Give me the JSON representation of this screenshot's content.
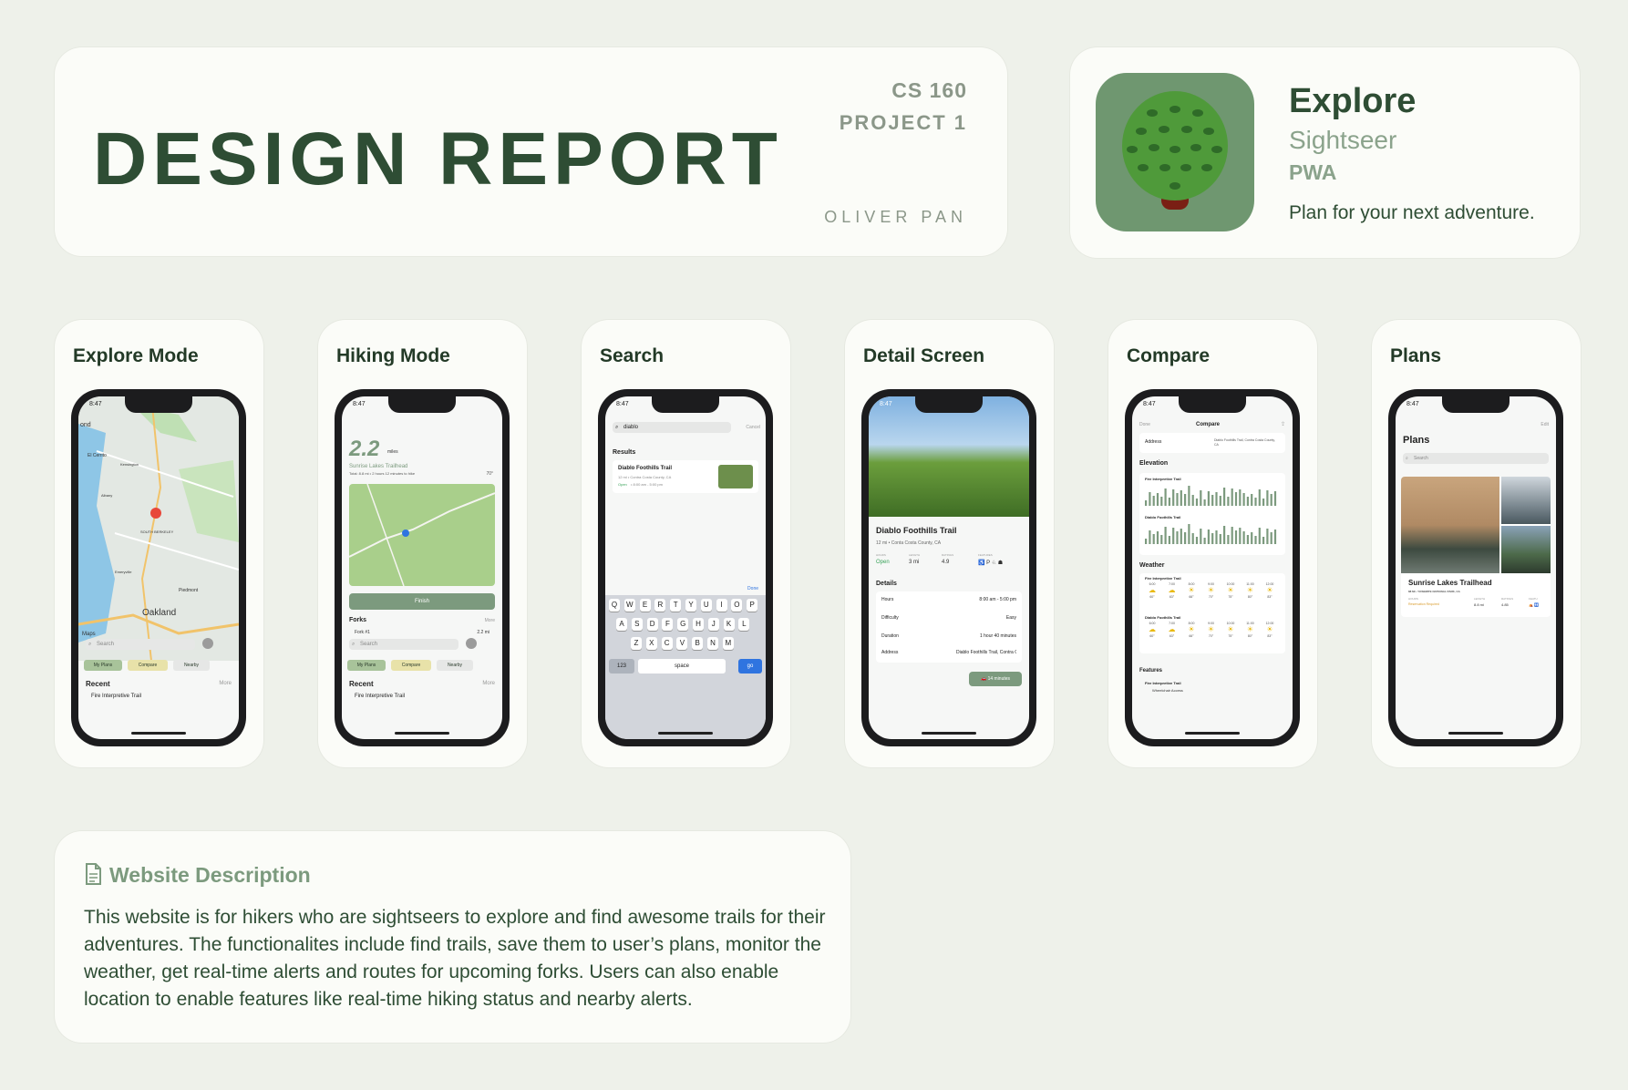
{
  "header": {
    "title": "DESIGN REPORT",
    "course": "CS 160",
    "project": "PROJECT 1",
    "author": "OLIVER PAN"
  },
  "app": {
    "name": "Explore",
    "subtitle": "Sightseer",
    "type": "PWA",
    "tagline": "Plan for your next adventure.",
    "icon": "tree-icon"
  },
  "screens": [
    {
      "label": "Explore Mode",
      "time": "8:47",
      "map_city": "Oakland",
      "map_labels": [
        "ond",
        "El Cerrito",
        "Kensington",
        "Albany",
        "SOUTH BERKELEY",
        "Piedmont",
        "Emeryville",
        "Maps"
      ],
      "search_placeholder": "Search",
      "chips": [
        "My Plans",
        "Compare",
        "Nearby"
      ],
      "recent_label": "Recent",
      "more": "More",
      "recent_item": "Fire Interpretive Trail"
    },
    {
      "label": "Hiking Mode",
      "time": "8:47",
      "distance": "2.2",
      "unit": "miles",
      "trail": "Sunrise Lakes Trailhead",
      "stats": "Total: 8.8 mi • 2 hours 12 minutes to hike",
      "temp": "70°",
      "finish": "Finish",
      "forks": "Forks",
      "more": "More",
      "fork_item": "Fork #1",
      "fork_dist": "2.2 mi",
      "search_placeholder": "Search",
      "chips": [
        "My Plans",
        "Compare",
        "Nearby"
      ],
      "recent_label": "Recent",
      "recent_item": "Fire Interpretive Trail"
    },
    {
      "label": "Search",
      "time": "8:47",
      "query": "diablo",
      "cancel": "Cancel",
      "results": "Results",
      "result_title": "Diablo Foothills Trail",
      "result_sub": "12 mi • Contra Costa County, CA",
      "result_status": "Open",
      "result_hours": "• 8:00 am - 5:00 pm",
      "done": "Done",
      "keys_row1": [
        "Q",
        "W",
        "E",
        "R",
        "T",
        "Y",
        "U",
        "I",
        "O",
        "P"
      ],
      "keys_row2": [
        "A",
        "S",
        "D",
        "F",
        "G",
        "H",
        "J",
        "K",
        "L"
      ],
      "keys_row3": [
        "Z",
        "X",
        "C",
        "V",
        "B",
        "N",
        "M"
      ],
      "key_123": "123",
      "key_space": "space",
      "key_go": "go"
    },
    {
      "label": "Detail Screen",
      "time": "8:47",
      "title": "Diablo Foothills Trail",
      "sub": "12 mi • Conta Costa County, CA",
      "stat_labels": [
        "HOURS",
        "LENGTH",
        "RATINGS",
        "FEATURES"
      ],
      "stat_values": [
        "Open",
        "3 mi",
        "4.9",
        "♿ P ♘ ☗"
      ],
      "details": "Details",
      "rows": [
        [
          "Hours",
          "8:00 am - 5:00 pm"
        ],
        [
          "Difficulty",
          "Easy"
        ],
        [
          "Duration",
          "1 hour 40 minutes"
        ],
        [
          "Address",
          "Diablo Foothills Trail, Contra Costa County, CA"
        ]
      ],
      "drive": "14 minutes"
    },
    {
      "label": "Compare",
      "time": "8:47",
      "done": "Done",
      "title": "Compare",
      "address_label": "Address",
      "address_value": "Diablo Foothills Trail, Contra Costa County, CA",
      "elevation": "Elevation",
      "trail_a": "Fire Interpretive Trail",
      "trail_b": "Diablo Foothills Trail",
      "weather": "Weather",
      "hours": [
        "6:00",
        "7:00",
        "8:00",
        "9:00",
        "10:00",
        "11:00",
        "12:00"
      ],
      "temps_a": [
        "60°",
        "63°",
        "66°",
        "70°",
        "75°",
        "80°",
        "83°"
      ],
      "temps_b": [
        "60°",
        "63°",
        "66°",
        "70°",
        "75°",
        "80°",
        "83°"
      ],
      "features": "Features",
      "feature_trail": "Fire Interpretive Trail",
      "feature_item": "Wheelchair Access"
    },
    {
      "label": "Plans",
      "time": "8:47",
      "edit": "Edit",
      "title": "Plans",
      "search_placeholder": "Search",
      "plan_title": "Sunrise Lakes Trailhead",
      "plan_sub": "88 MI • YOSEMITE NATIONAL PARK, CA",
      "stat_labels": [
        "HOURS",
        "LENGTH",
        "RATINGS",
        "FEATU"
      ],
      "stat_values": [
        "Reservation Required",
        "8.8 mi",
        "4.85",
        "⛺ 🚻"
      ]
    }
  ],
  "description": {
    "heading": "Website Description",
    "icon": "document-icon",
    "text": "This website is for hikers who are sightseers to explore and find awesome trails for their adventures. The functionalites include find trails, save them to user’s plans, monitor the weather, get real-time alerts and routes for upcoming forks. Users can also enable location to enable features like real-time hiking status and  nearby alerts."
  },
  "colors": {
    "background": "#eef1ea",
    "card": "#fbfcf8",
    "title": "#2e4d34",
    "muted": "#8b9789",
    "accent": "#7c9a7e",
    "app_icon": "#6f9770",
    "chip_green": "#a8c39a",
    "chip_yellow": "#e8e2a9"
  }
}
